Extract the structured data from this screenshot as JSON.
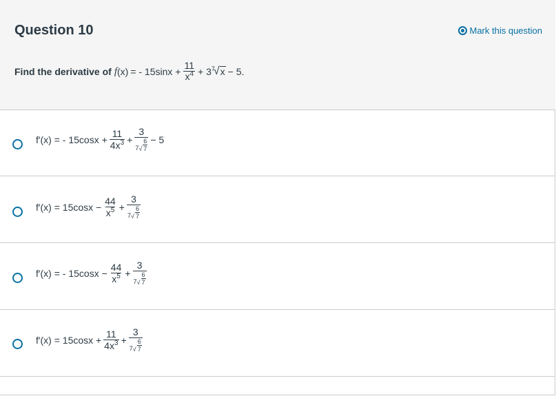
{
  "question": {
    "title": "Question 10",
    "mark_label": "Mark this question",
    "prompt_lead": "Find the derivative of",
    "prompt_fx": "f",
    "prompt_x": "(x)",
    "prompt_eq": "= - 15sinx +",
    "prompt_frac_num": "11",
    "prompt_frac_den_base": "x",
    "prompt_frac_den_exp": "4",
    "prompt_plus": "+ 3",
    "prompt_root_index": "7",
    "prompt_radicand": "x",
    "prompt_tail": "− 5."
  },
  "answers": [
    {
      "lhs": "f′(x) = - 15cosx +",
      "frac1_num": "11",
      "frac1_den_base": "4x",
      "frac1_den_exp": "3",
      "op": "+",
      "frac2_num": "3",
      "frac2_root_index": "7",
      "frac2_inner_num": "6",
      "frac2_inner_den": "7",
      "tail": "− 5"
    },
    {
      "lhs": "f′(x) = 15cosx −",
      "frac1_num": "44",
      "frac1_den_base": "x",
      "frac1_den_exp": "5",
      "op": "+",
      "frac2_num": "3",
      "frac2_root_index": "7",
      "frac2_inner_num": "6",
      "frac2_inner_den": "7",
      "tail": ""
    },
    {
      "lhs": "f′(x) = - 15cosx −",
      "frac1_num": "44",
      "frac1_den_base": "x",
      "frac1_den_exp": "5",
      "op": "+",
      "frac2_num": "3",
      "frac2_root_index": "7",
      "frac2_inner_num": "6",
      "frac2_inner_den": "7",
      "tail": ""
    },
    {
      "lhs": "f′(x) = 15cosx +",
      "frac1_num": "11",
      "frac1_den_base": "4x",
      "frac1_den_exp": "3",
      "op": "+",
      "frac2_num": "3",
      "frac2_root_index": "7",
      "frac2_inner_num": "6",
      "frac2_inner_den": "7",
      "tail": ""
    }
  ],
  "colors": {
    "accent": "#0770a3",
    "text": "#2d3b45",
    "header_bg": "#f5f5f5",
    "border": "#c7cdd1"
  }
}
